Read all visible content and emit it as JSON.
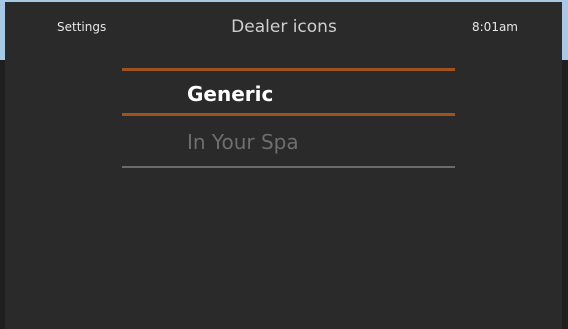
{
  "header": {
    "back_label": "Settings",
    "title": "Dealer icons",
    "time": "8:01am"
  },
  "list": {
    "items": [
      {
        "label": "Generic",
        "selected": true
      },
      {
        "label": "In Your Spa",
        "selected": false
      }
    ]
  },
  "colors": {
    "background": "#2a2a2a",
    "selection_accent": "#a0521f",
    "divider": "#6a6a6a"
  }
}
